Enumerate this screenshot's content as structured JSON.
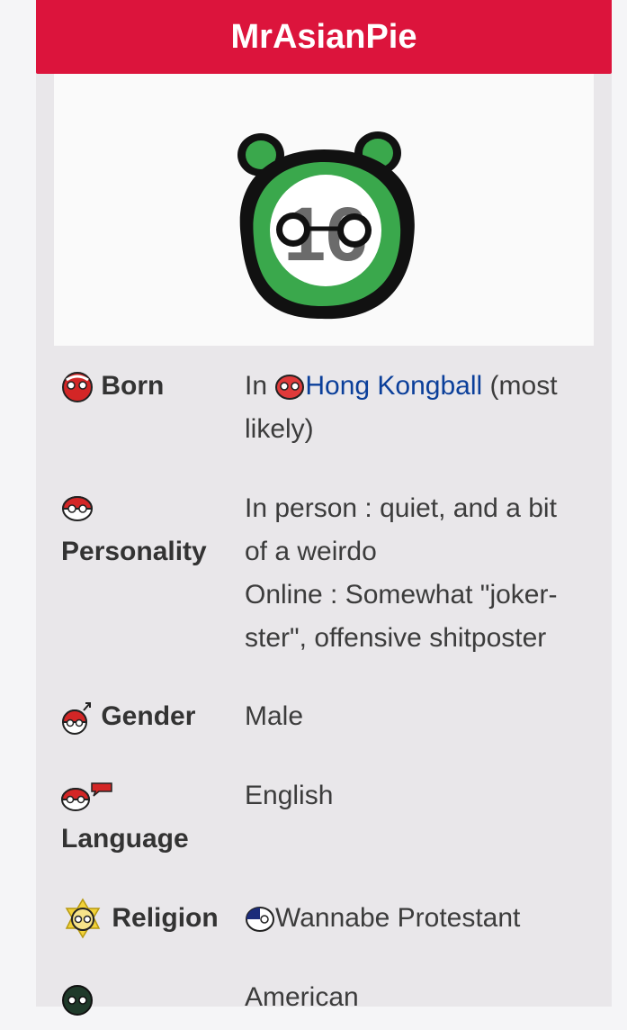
{
  "infobox": {
    "title": "MrAsianPie",
    "avatar_icon": "green-ball-avatar-16",
    "avatar_text": "16",
    "rows": [
      {
        "label": "Born",
        "icon": "red-ball-icon",
        "value_prefix": "In ",
        "value_link": "Hong Kongball",
        "value_link_icon": "hong-kong-ball-icon",
        "value_suffix_line1": " (most",
        "value_suffix_line2": "likely)"
      },
      {
        "label": "Personality",
        "icon": "red-white-ball-icon",
        "value_lines": [
          "In person : quiet, and a bit",
          "of a weirdo",
          "Online : Somewhat \"joker-",
          "ster\", offensive shitposter"
        ]
      },
      {
        "label": "Gender",
        "icon": "male-ball-icon",
        "value": "Male"
      },
      {
        "label": "Language",
        "icon": "speaking-ball-icon",
        "value": "English"
      },
      {
        "label": "Religion",
        "icon": "religion-ball-icon",
        "value": "Wannabe Protestant",
        "value_icon": "protestant-ball-icon"
      },
      {
        "label": "",
        "icon": "dark-ball-icon",
        "value": "American"
      }
    ]
  },
  "colors": {
    "title_bg": "#dc143c",
    "link": "#0b3f9a",
    "avatar_green": "#3aa84c"
  }
}
